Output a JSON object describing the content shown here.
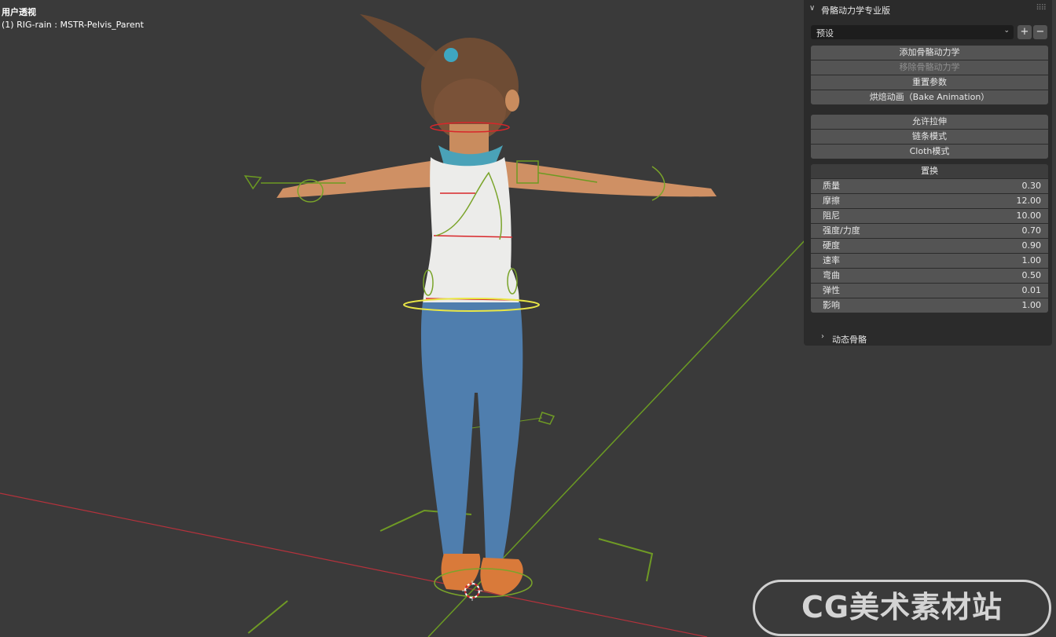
{
  "viewport": {
    "mode_label": "用户透视",
    "object_label": "(1) RIG-rain : MSTR-Pelvis_Parent"
  },
  "panel": {
    "title": "骨骼动力学专业版",
    "preset": {
      "value": "预设",
      "add": "+",
      "remove": "−"
    },
    "actions": [
      {
        "label": "添加骨骼动力学",
        "enabled": true
      },
      {
        "label": "移除骨骼动力学",
        "enabled": false
      },
      {
        "label": "重置参数",
        "enabled": true
      },
      {
        "label": "烘焙动画（Bake Animation）",
        "enabled": true
      }
    ],
    "modes": [
      {
        "label": "允许拉伸"
      },
      {
        "label": "链条模式"
      },
      {
        "label": "Cloth模式"
      }
    ],
    "section_title": "置换",
    "properties": [
      {
        "label": "质量",
        "value": "0.30"
      },
      {
        "label": "摩擦",
        "value": "12.00"
      },
      {
        "label": "阻尼",
        "value": "10.00"
      },
      {
        "label": "强度/力度",
        "value": "0.70"
      },
      {
        "label": "硬度",
        "value": "0.90"
      },
      {
        "label": "速率",
        "value": "1.00"
      },
      {
        "label": "弯曲",
        "value": "0.50"
      },
      {
        "label": "弹性",
        "value": "0.01"
      },
      {
        "label": "影响",
        "value": "1.00"
      }
    ],
    "subpanel_label": "动态骨骼"
  },
  "watermark": "CG美术素材站",
  "colors": {
    "viewport_bg": "#3a3a3a",
    "panel_bg": "#2b2b2b",
    "button_bg": "#545454",
    "x_axis": "#b5323c",
    "y_axis": "#6b9a23",
    "bone_green": "#7aa42a",
    "bone_selected": "#e9e646"
  }
}
